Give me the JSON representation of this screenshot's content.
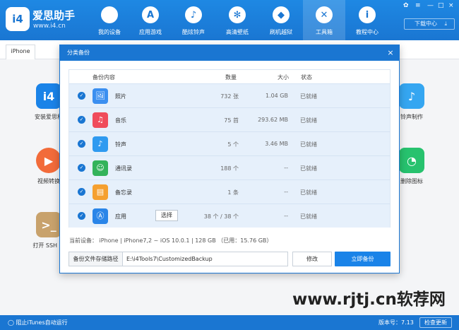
{
  "header": {
    "logo_text": "i4",
    "brand": "爱思助手",
    "url": "www.i4.cn",
    "nav": [
      {
        "label": "我的设备",
        "icon": "apple-icon"
      },
      {
        "label": "应用游戏",
        "icon": "app-store-icon"
      },
      {
        "label": "酷炫铃声",
        "icon": "bell-icon"
      },
      {
        "label": "高清壁纸",
        "icon": "gear-wallpaper-icon"
      },
      {
        "label": "刷机越狱",
        "icon": "dropbox-icon"
      },
      {
        "label": "工具箱",
        "icon": "tools-icon"
      },
      {
        "label": "教程中心",
        "icon": "info-icon"
      }
    ],
    "download_label": "下载中心"
  },
  "device_tab": "iPhone",
  "tools": [
    {
      "label": "安装爱思移",
      "icon_text": "i4",
      "color": "#1a83e8"
    },
    {
      "label": "视频转换",
      "icon_text": "▶",
      "color": "#f26b3a"
    },
    {
      "label": "打开 SSH 通",
      "icon_text": ">_",
      "color": "#c8a26c"
    },
    {
      "label": "铃声制作",
      "icon_text": "🔔",
      "color": "#35a6f1"
    },
    {
      "label": "删除图标",
      "icon_text": "◔",
      "color": "#27c26e"
    }
  ],
  "dialog": {
    "title": "分类备份",
    "close": "×",
    "columns": {
      "content": "备份内容",
      "count": "数量",
      "size": "大小",
      "status": "状态"
    },
    "rows": [
      {
        "name": "照片",
        "count": "732 张",
        "size": "1.04 GB",
        "status": "已就绪",
        "color": "#3b8ff0",
        "icon": "🖼"
      },
      {
        "name": "音乐",
        "count": "75 首",
        "size": "293.62 MB",
        "status": "已就绪",
        "color": "#f04c5b",
        "icon": "♫"
      },
      {
        "name": "铃声",
        "count": "5 个",
        "size": "3.46 MB",
        "status": "已就绪",
        "color": "#2f9af0",
        "icon": "🔔"
      },
      {
        "name": "通讯录",
        "count": "188 个",
        "size": "--",
        "status": "已就绪",
        "color": "#33b35a",
        "icon": "👤"
      },
      {
        "name": "备忘录",
        "count": "1 条",
        "size": "--",
        "status": "已就绪",
        "color": "#f5a030",
        "icon": "▤"
      },
      {
        "name": "应用",
        "count": "38 个 / 38 个",
        "size": "--",
        "status": "已就绪",
        "color": "#2a85e8",
        "icon": "Ⓐ",
        "select_label": "选择"
      }
    ],
    "device_info": "当前设备： iPhone    |    iPhone7,2 ~ iOS 10.0.1    |    128 GB （已用：15.76 GB）",
    "path_label": "备份文件存储路径",
    "path_value": "E:\\i4Tools7\\CustomizedBackup",
    "modify_label": "修改",
    "backup_label": "立即备份"
  },
  "statusbar": {
    "itunes": "阻止iTunes自动运行",
    "version": "版本号：7.13",
    "update": "检查更新"
  },
  "watermark": "www.rjtj.cn软荐网"
}
